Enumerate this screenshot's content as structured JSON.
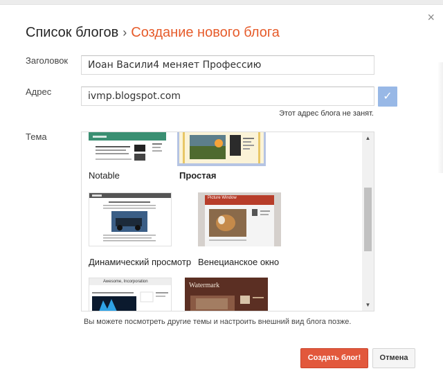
{
  "dialog": {
    "close_glyph": "×",
    "breadcrumb": {
      "list_label": "Список блогов",
      "separator": "›",
      "current_label": "Создание нового блога"
    }
  },
  "form": {
    "title_label": "Заголовок",
    "title_value": "Иоан  Васили4 меняет Профессию",
    "address_label": "Адрес",
    "address_value": "ivmp.blogspot.com",
    "address_check_icon": "✓",
    "address_status": "Этот адрес блога не занят.",
    "theme_label": "Тема"
  },
  "themes": {
    "items": [
      {
        "name": "Notable",
        "selected": false
      },
      {
        "name": "Простая",
        "selected": true
      },
      {
        "name": "Динамический просмотр",
        "selected": false
      },
      {
        "name": "Венецианское окно",
        "selected": false
      }
    ],
    "partial_thumbnail_texts": {
      "awesome": "Awesome, Incorporation",
      "watermark": "Watermark",
      "picture_window": "Picture Window"
    }
  },
  "scrollbar": {
    "up_glyph": "▲",
    "down_glyph": "▼"
  },
  "hint": "Вы можете посмотреть другие темы и настроить внешний вид блога позже.",
  "buttons": {
    "create_label": "Создать блог!",
    "cancel_label": "Отмена"
  },
  "colors": {
    "accent_orange": "#e65b2a",
    "create_button": "#e2583c",
    "check_button": "#98b8e6",
    "selected_theme_border": "#b5c4e3"
  }
}
